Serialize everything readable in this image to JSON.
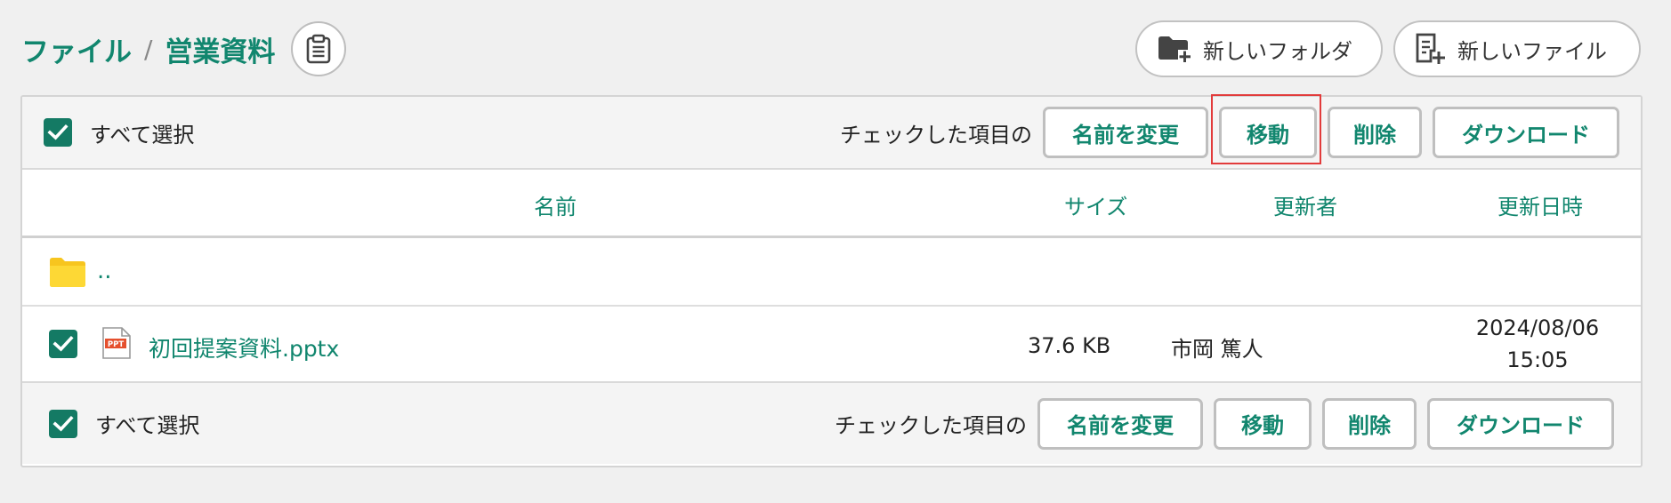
{
  "breadcrumb": {
    "root": "ファイル",
    "separator": "/",
    "current": "営業資料"
  },
  "header_actions": {
    "new_folder": "新しいフォルダ",
    "new_file": "新しいファイル"
  },
  "toolbar": {
    "select_all": "すべて選択",
    "checked_items_note": "チェックした項目の",
    "rename": "名前を変更",
    "move": "移動",
    "delete": "削除",
    "download": "ダウンロード"
  },
  "table": {
    "columns": {
      "name": "名前",
      "size": "サイズ",
      "updated_by": "更新者",
      "updated_at": "更新日時"
    },
    "parent_link": "..",
    "rows": [
      {
        "name": "初回提案資料.pptx",
        "file_badge": "PPT",
        "size": "37.6 KB",
        "updated_by": "市岡 篤人",
        "date": "2024/08/06",
        "time": "15:05",
        "checked": true
      }
    ]
  },
  "colors": {
    "accent": "#11866e",
    "checkbox": "#147a64",
    "highlight": "#e23b3b",
    "folder": "#f5c518"
  }
}
